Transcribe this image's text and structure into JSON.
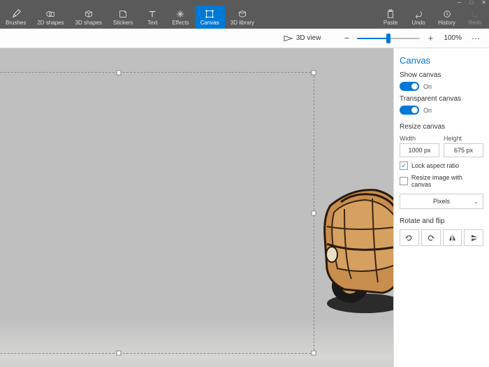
{
  "toolbar": {
    "brushes": "Brushes",
    "shapes2d": "2D shapes",
    "shapes3d": "3D shapes",
    "stickers": "Stickers",
    "text": "Text",
    "effects": "Effects",
    "canvas": "Canvas",
    "library3d": "3D library",
    "paste": "Paste",
    "undo": "Undo",
    "history": "History",
    "redo": "Redo"
  },
  "subbar": {
    "view3d": "3D view",
    "zoom": "100%"
  },
  "panel": {
    "title": "Canvas",
    "show_canvas": "Show canvas",
    "show_canvas_state": "On",
    "transparent_canvas": "Transparent canvas",
    "transparent_state": "On",
    "resize_canvas": "Resize canvas",
    "width_label": "Width",
    "width_value": "1000 px",
    "height_label": "Height",
    "height_value": "675 px",
    "lock_aspect": "Lock aspect ratio",
    "resize_image": "Resize image with canvas",
    "units": "Pixels",
    "rotate_flip": "Rotate and flip"
  }
}
